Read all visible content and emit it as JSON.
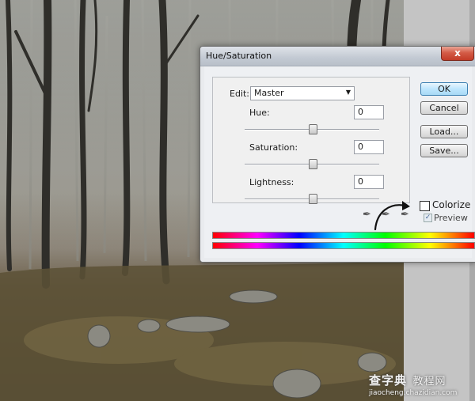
{
  "dialog": {
    "title": "Hue/Saturation",
    "close_label": "x",
    "edit_label": "Edit:",
    "edit_value": "Master",
    "sliders": [
      {
        "label": "Hue:",
        "value": "0"
      },
      {
        "label": "Saturation:",
        "value": "0"
      },
      {
        "label": "Lightness:",
        "value": "0"
      }
    ],
    "buttons": {
      "ok": "OK",
      "cancel": "Cancel",
      "load": "Load...",
      "save": "Save..."
    },
    "colorize_label": "Colorize",
    "preview_label": "Preview",
    "colorize_checked": false,
    "preview_checked": true
  },
  "watermark": {
    "line1": "查字典",
    "line1b": "教程网",
    "line2": "jiaocheng.chazidian.com"
  },
  "icons": [
    "eyedropper-icon",
    "eyedropper-plus-icon",
    "eyedropper-minus-icon",
    "close-icon",
    "checkmark-icon",
    "dropdown-arrow-icon"
  ]
}
